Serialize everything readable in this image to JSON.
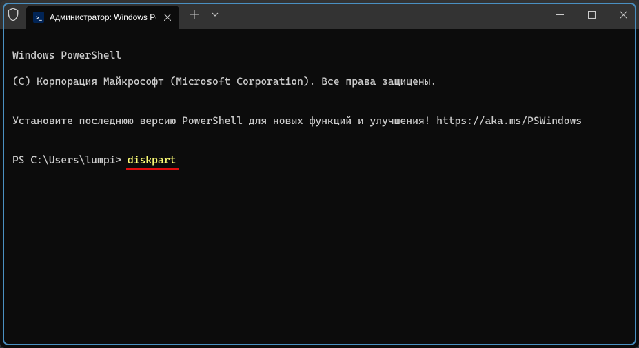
{
  "titlebar": {
    "tab_title": "Администратор: Windows Po",
    "icons": {
      "shield": "shield-icon",
      "powershell": "powershell-icon",
      "close_tab": "close-icon",
      "new_tab": "plus-icon",
      "dropdown": "chevron-down-icon",
      "minimize": "minimize-icon",
      "maximize": "maximize-icon",
      "window_close": "close-icon"
    }
  },
  "terminal": {
    "line1": "Windows PowerShell",
    "line2": "(C) Корпорация Майкрософт (Microsoft Corporation). Все права защищены.",
    "line3": "",
    "line4": "Установите последнюю версию PowerShell для новых функций и улучшения! https://aka.ms/PSWindows",
    "line5": "",
    "prompt": "PS C:\\Users\\lumpi> ",
    "command": "diskpart"
  },
  "colors": {
    "background": "#0c0c0c",
    "titlebar": "#333333",
    "text": "#cccccc",
    "command": "#ffff77",
    "annotation": "#e20f0f",
    "border": "#4a90c2"
  }
}
